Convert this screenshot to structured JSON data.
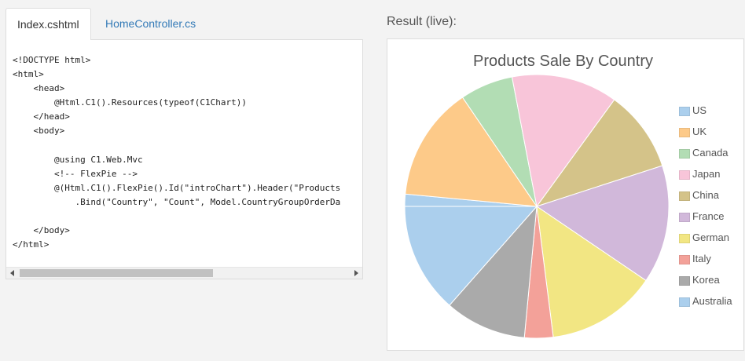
{
  "tabs": [
    {
      "label": "Index.cshtml",
      "active": true
    },
    {
      "label": "HomeController.cs",
      "active": false
    }
  ],
  "code_lines": [
    "<!DOCTYPE html>",
    "<html>",
    "    <head>",
    "        @Html.C1().Resources(typeof(C1Chart))",
    "    </head>",
    "    <body>",
    "",
    "        @using C1.Web.Mvc",
    "        <!-- FlexPie -->",
    "        @(Html.C1().FlexPie().Id(\"introChart\").Header(\"Products",
    "            .Bind(\"Country\", \"Count\", Model.CountryGroupOrderDa",
    "",
    "    </body>",
    "</html>"
  ],
  "result_label": "Result (live):",
  "chart_data": {
    "type": "pie",
    "title": "Products Sale By Country",
    "legend_position": "right",
    "series": [
      {
        "name": "US",
        "value": 1.5,
        "color": "#abcfed"
      },
      {
        "name": "UK",
        "value": 14.0,
        "color": "#fdca89"
      },
      {
        "name": "Canada",
        "value": 6.5,
        "color": "#b2ddb4"
      },
      {
        "name": "Japan",
        "value": 13.0,
        "color": "#f8c5d9"
      },
      {
        "name": "China",
        "value": 10.0,
        "color": "#d4c389"
      },
      {
        "name": "France",
        "value": 14.5,
        "color": "#d1b8da"
      },
      {
        "name": "German",
        "value": 13.5,
        "color": "#f2e683"
      },
      {
        "name": "Italy",
        "value": 3.5,
        "color": "#f3a199"
      },
      {
        "name": "Korea",
        "value": 10.0,
        "color": "#aaaaaa"
      },
      {
        "name": "Australia",
        "value": 13.5,
        "color": "#abcfed"
      }
    ]
  }
}
